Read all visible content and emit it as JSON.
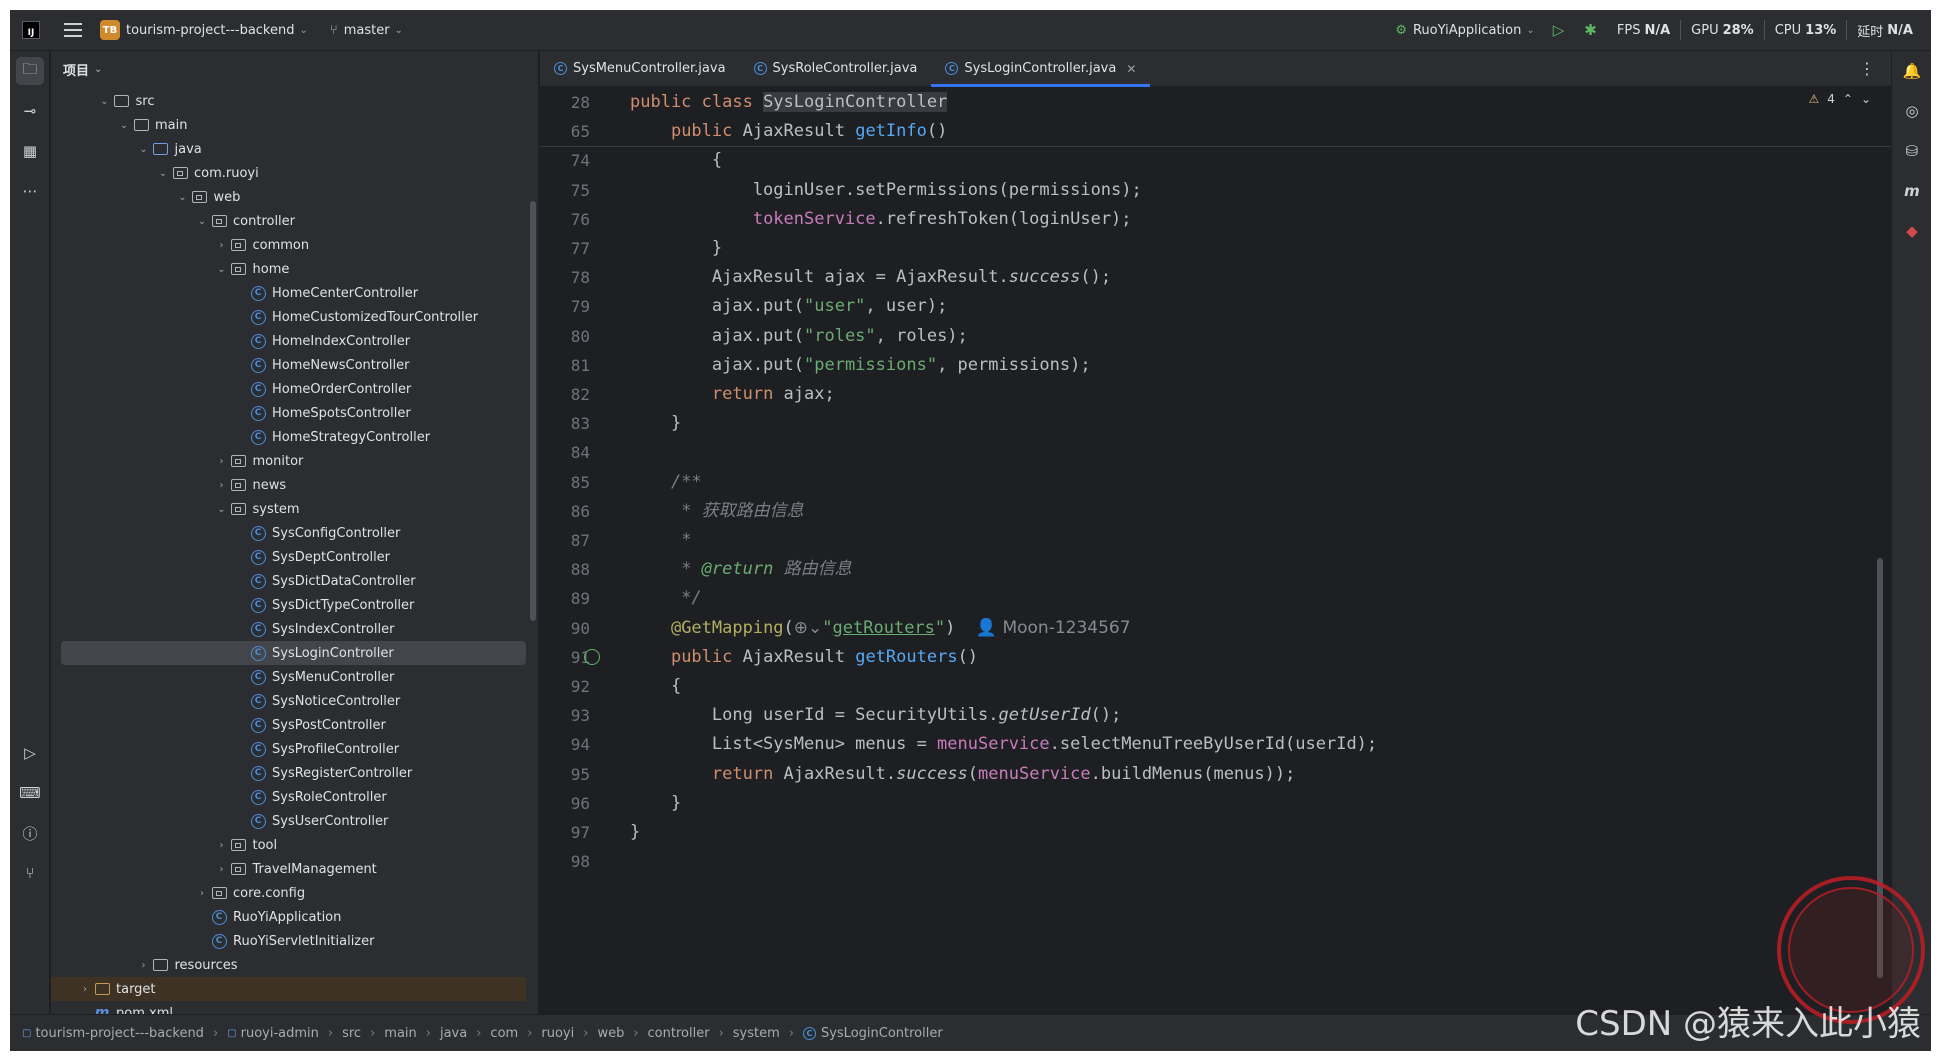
{
  "titlebar": {
    "project_badge": "TB",
    "project_name": "tourism-project---backend",
    "branch": "master",
    "run_config": "RuoYiApplication",
    "metrics": [
      {
        "label": "FPS",
        "value": "N/A"
      },
      {
        "label": "GPU",
        "value": "28%"
      },
      {
        "label": "CPU",
        "value": "13%"
      },
      {
        "label": "延时",
        "value": "N/A"
      }
    ]
  },
  "project_panel": {
    "title": "项目",
    "tree": [
      {
        "label": "src",
        "kind": "folder",
        "depth": 2,
        "expanded": true
      },
      {
        "label": "main",
        "kind": "folder",
        "depth": 3,
        "expanded": true
      },
      {
        "label": "java",
        "kind": "src-folder",
        "depth": 4,
        "expanded": true
      },
      {
        "label": "com.ruoyi",
        "kind": "package",
        "depth": 5,
        "expanded": true
      },
      {
        "label": "web",
        "kind": "package",
        "depth": 6,
        "expanded": true
      },
      {
        "label": "controller",
        "kind": "package",
        "depth": 7,
        "expanded": true
      },
      {
        "label": "common",
        "kind": "package",
        "depth": 8,
        "expanded": false
      },
      {
        "label": "home",
        "kind": "package",
        "depth": 8,
        "expanded": true
      },
      {
        "label": "HomeCenterController",
        "kind": "class",
        "depth": 9
      },
      {
        "label": "HomeCustomizedTourController",
        "kind": "class",
        "depth": 9
      },
      {
        "label": "HomeIndexController",
        "kind": "class",
        "depth": 9
      },
      {
        "label": "HomeNewsController",
        "kind": "class",
        "depth": 9
      },
      {
        "label": "HomeOrderController",
        "kind": "class",
        "depth": 9
      },
      {
        "label": "HomeSpotsController",
        "kind": "class",
        "depth": 9
      },
      {
        "label": "HomeStrategyController",
        "kind": "class",
        "depth": 9
      },
      {
        "label": "monitor",
        "kind": "package",
        "depth": 8,
        "expanded": false
      },
      {
        "label": "news",
        "kind": "package",
        "depth": 8,
        "expanded": false
      },
      {
        "label": "system",
        "kind": "package",
        "depth": 8,
        "expanded": true
      },
      {
        "label": "SysConfigController",
        "kind": "class",
        "depth": 9
      },
      {
        "label": "SysDeptController",
        "kind": "class",
        "depth": 9
      },
      {
        "label": "SysDictDataController",
        "kind": "class",
        "depth": 9
      },
      {
        "label": "SysDictTypeController",
        "kind": "class",
        "depth": 9
      },
      {
        "label": "SysIndexController",
        "kind": "class",
        "depth": 9
      },
      {
        "label": "SysLoginController",
        "kind": "class",
        "depth": 9,
        "selected": true
      },
      {
        "label": "SysMenuController",
        "kind": "class",
        "depth": 9
      },
      {
        "label": "SysNoticeController",
        "kind": "class",
        "depth": 9
      },
      {
        "label": "SysPostController",
        "kind": "class",
        "depth": 9
      },
      {
        "label": "SysProfileController",
        "kind": "class",
        "depth": 9
      },
      {
        "label": "SysRegisterController",
        "kind": "class",
        "depth": 9
      },
      {
        "label": "SysRoleController",
        "kind": "class",
        "depth": 9
      },
      {
        "label": "SysUserController",
        "kind": "class",
        "depth": 9
      },
      {
        "label": "tool",
        "kind": "package",
        "depth": 8,
        "expanded": false
      },
      {
        "label": "TravelManagement",
        "kind": "package",
        "depth": 8,
        "expanded": false
      },
      {
        "label": "core.config",
        "kind": "package",
        "depth": 7,
        "expanded": false
      },
      {
        "label": "RuoYiApplication",
        "kind": "app-class",
        "depth": 7
      },
      {
        "label": "RuoYiServletInitializer",
        "kind": "class",
        "depth": 7
      },
      {
        "label": "resources",
        "kind": "res-folder",
        "depth": 4,
        "expanded": false
      },
      {
        "label": "target",
        "kind": "target-folder",
        "depth": 1,
        "expanded": false,
        "highlight": true
      },
      {
        "label": "pom.xml",
        "kind": "maven",
        "depth": 1
      }
    ]
  },
  "editor": {
    "tabs": [
      {
        "label": "SysMenuController.java",
        "active": false
      },
      {
        "label": "SysRoleController.java",
        "active": false
      },
      {
        "label": "SysLoginController.java",
        "active": true
      }
    ],
    "warnings": "4",
    "sticky_lines": [
      {
        "num": "28",
        "html": "<span class=\"kw\">public class </span><span class=\"hl-class\">SysLoginController</span>"
      },
      {
        "num": "65",
        "html": "    <span class=\"kw\">public </span>AjaxResult <span class=\"fn\">getInfo</span>()"
      }
    ],
    "lines": [
      {
        "num": "74",
        "html": "        {"
      },
      {
        "num": "75",
        "html": "            loginUser.setPermissions(permissions);"
      },
      {
        "num": "76",
        "html": "            <span class=\"field\">tokenService</span>.refreshToken(loginUser);"
      },
      {
        "num": "77",
        "html": "        }"
      },
      {
        "num": "78",
        "html": "        AjaxResult ajax = AjaxResult.<span class=\"static-it\">success</span>();"
      },
      {
        "num": "79",
        "html": "        ajax.put(<span class=\"str\">\"user\"</span>, user);"
      },
      {
        "num": "80",
        "html": "        ajax.put(<span class=\"str\">\"roles\"</span>, roles);"
      },
      {
        "num": "81",
        "html": "        ajax.put(<span class=\"str\">\"permissions\"</span>, permissions);"
      },
      {
        "num": "82",
        "html": "        <span class=\"kw\">return </span>ajax;"
      },
      {
        "num": "83",
        "html": "    }"
      },
      {
        "num": "84",
        "html": ""
      },
      {
        "num": "85",
        "html": "    <span class=\"cmt\">/**</span>"
      },
      {
        "num": "86",
        "html": "    <span class=\"cmt\"> * 获取路由信息</span>"
      },
      {
        "num": "87",
        "html": "    <span class=\"cmt\"> *</span>"
      },
      {
        "num": "88",
        "html": "    <span class=\"cmt\"> * </span><span class=\"tag\">@return</span><span class=\"cmt\"> 路由信息</span>"
      },
      {
        "num": "89",
        "html": "    <span class=\"cmt\"> */</span>"
      },
      {
        "num": "90",
        "html": "    <span class=\"anno\">@GetMapping</span>(<span class=\"inlay\">⊕⌄</span><span class=\"str\">\"<span class=\"underline\">getRouters</span>\"</span>)  <span class=\"inlay\">👤 Moon-1234567</span>"
      },
      {
        "num": "91",
        "html": "    <span class=\"kw\">public </span>AjaxResult <span class=\"fn\">getRouters</span>()"
      },
      {
        "num": "92",
        "html": "    {"
      },
      {
        "num": "93",
        "html": "        Long userId = SecurityUtils.<span class=\"static-it\">getUserId</span>();"
      },
      {
        "num": "94",
        "html": "        List&lt;SysMenu&gt; menus = <span class=\"field\">menuService</span>.selectMenuTreeByUserId(userId);"
      },
      {
        "num": "95",
        "html": "        <span class=\"kw\">return </span>AjaxResult.<span class=\"static-it\">success</span>(<span class=\"field\">menuService</span>.buildMenus(menus));"
      },
      {
        "num": "96",
        "html": "    }"
      },
      {
        "num": "97",
        "html": "}"
      },
      {
        "num": "98",
        "html": ""
      }
    ]
  },
  "statusbar": {
    "breadcrumbs": [
      "tourism-project---backend",
      "ruoyi-admin",
      "src",
      "main",
      "java",
      "com",
      "ruoyi",
      "web",
      "controller",
      "system",
      "SysLoginController"
    ]
  },
  "watermark": "CSDN @猿来入此小猿"
}
